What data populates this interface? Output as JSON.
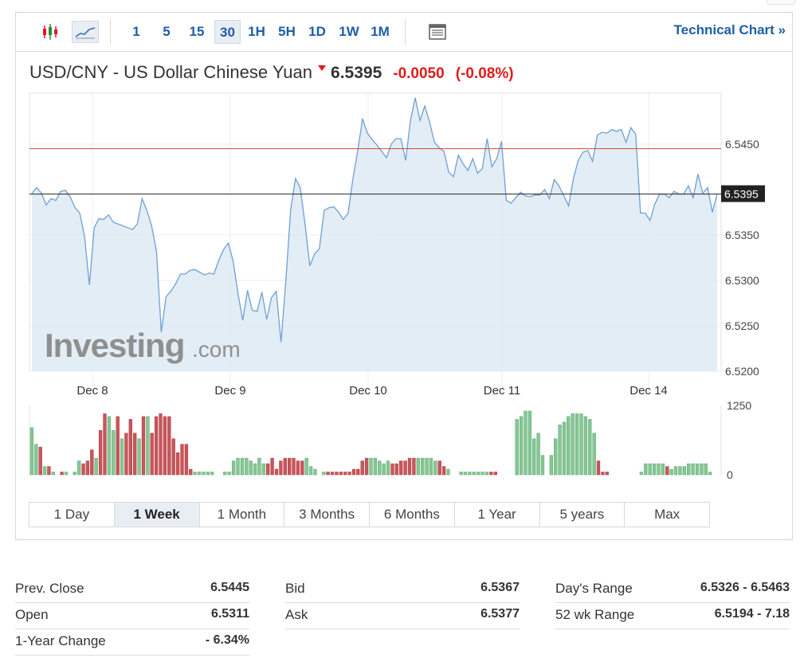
{
  "toolbar": {
    "chart_type_icons": [
      {
        "name": "candlestick-icon",
        "color": "#e01b1b"
      },
      {
        "name": "line-area-icon",
        "color": "#1b5fa8"
      }
    ],
    "intervals": [
      "1",
      "5",
      "15",
      "30",
      "1H",
      "5H",
      "1D",
      "1W",
      "1M"
    ],
    "active_interval": "30",
    "table_icon": "table-view-icon",
    "technical_chart_label": "Technical Chart »"
  },
  "quote": {
    "name": "USD/CNY - US Dollar Chinese Yuan",
    "price": "6.5395",
    "change": "-0.0050",
    "change_pct": "(-0.08%)",
    "direction_icon": "arrow-down-icon"
  },
  "watermark": {
    "brand": "Investing",
    "suffix": ".com"
  },
  "chart_data": {
    "type": "area",
    "x_labels": [
      "Dec 8",
      "Dec 9",
      "Dec 10",
      "Dec 11",
      "Dec 14"
    ],
    "y_ticks": [
      "6.5450",
      "6.5350",
      "6.5300",
      "6.5250",
      "6.5200"
    ],
    "ylim": [
      6.52,
      6.5506
    ],
    "current_price": 6.5395,
    "current_price_label": "6.5395",
    "prev_close": 6.5445,
    "series": [
      {
        "values": [
          6.5396,
          6.5402,
          6.5396,
          6.5383,
          6.539,
          6.5388,
          6.5398,
          6.5399,
          6.5392,
          6.538,
          6.5374,
          6.5348,
          6.5295,
          6.5358,
          6.5368,
          6.5367,
          6.5372,
          6.5364,
          6.5362,
          6.536,
          6.5358,
          6.5356,
          6.5362,
          6.539,
          6.5377,
          6.536,
          6.5332,
          6.5243,
          6.5282,
          6.5288,
          6.5296,
          6.5307,
          6.5307,
          6.5311,
          6.5312,
          6.5309,
          6.5306,
          6.5308,
          6.5307,
          6.5322,
          6.5334,
          6.5341,
          6.5321,
          6.5286,
          6.5256,
          6.5289,
          6.5267,
          6.5266,
          6.5287,
          6.5257,
          6.5281,
          6.5288,
          6.5232,
          6.5299,
          6.5378,
          6.5412,
          6.5402,
          6.5362,
          6.5316,
          6.5329,
          6.5335,
          6.5377,
          6.538,
          6.5381,
          6.5375,
          6.5367,
          6.5374,
          6.5412,
          6.5443,
          6.5478,
          6.5462,
          6.5455,
          6.5449,
          6.5442,
          6.5435,
          6.545,
          6.5456,
          6.5456,
          6.5432,
          6.5476,
          6.5501,
          6.5476,
          6.5492,
          6.5474,
          6.5452,
          6.5446,
          6.5442,
          6.5419,
          6.5414,
          6.5438,
          6.5428,
          6.5421,
          6.5434,
          6.5418,
          6.5423,
          6.5456,
          6.5425,
          6.5434,
          6.5453,
          6.5388,
          6.5385,
          6.5391,
          6.5397,
          6.5393,
          6.5392,
          6.5394,
          6.5394,
          6.54,
          6.539,
          6.5411,
          6.5404,
          6.5393,
          6.5382,
          6.5412,
          6.5432,
          6.5441,
          6.5443,
          6.5431,
          6.546,
          6.5463,
          6.5462,
          6.5466,
          6.5464,
          6.5466,
          6.5452,
          6.5468,
          6.5461,
          6.5374,
          6.5374,
          6.5366,
          6.5384,
          6.5395,
          6.5395,
          6.5391,
          6.5398,
          6.5395,
          6.5395,
          6.5404,
          6.5391,
          6.5417,
          6.5396,
          6.5402,
          6.5375,
          6.5395
        ]
      }
    ],
    "volume": {
      "ylim": [
        0,
        1250
      ],
      "y_ticks": [
        "1250",
        "0"
      ],
      "values": [
        850,
        550,
        500,
        150,
        150,
        50,
        0,
        50,
        50,
        0,
        50,
        250,
        200,
        250,
        450,
        300,
        800,
        1100,
        1050,
        800,
        1050,
        650,
        750,
        1000,
        750,
        650,
        1050,
        1050,
        750,
        1050,
        1100,
        1050,
        1050,
        650,
        400,
        550,
        550,
        100,
        50,
        50,
        50,
        50,
        50,
        0,
        0,
        50,
        50,
        250,
        300,
        300,
        300,
        250,
        200,
        300,
        200,
        200,
        300,
        100,
        250,
        300,
        300,
        300,
        250,
        250,
        300,
        150,
        100,
        0,
        50,
        50,
        50,
        50,
        50,
        50,
        50,
        100,
        100,
        250,
        300,
        300,
        300,
        250,
        200,
        250,
        200,
        200,
        250,
        250,
        300,
        300,
        300,
        300,
        300,
        300,
        250,
        250,
        150,
        100,
        0,
        0,
        50,
        50,
        50,
        50,
        50,
        50,
        50,
        50,
        50,
        0,
        0,
        0,
        0,
        1000,
        1050,
        1150,
        1150,
        650,
        750,
        350,
        0,
        350,
        650,
        900,
        950,
        1050,
        1100,
        1100,
        1100,
        1050,
        1000,
        750,
        250,
        50,
        50,
        0,
        0,
        0,
        0,
        0,
        0,
        0,
        50,
        200,
        200,
        200,
        200,
        200,
        150,
        100,
        150,
        150,
        150,
        200,
        200,
        200,
        200,
        200,
        50,
        0
      ],
      "colors": [
        "g",
        "g",
        "r",
        "g",
        "r",
        "g",
        "g",
        "r",
        "g",
        "g",
        "g",
        "g",
        "r",
        "r",
        "r",
        "g",
        "r",
        "r",
        "g",
        "g",
        "r",
        "g",
        "r",
        "r",
        "r",
        "g",
        "r",
        "g",
        "r",
        "r",
        "r",
        "r",
        "r",
        "r",
        "r",
        "r",
        "r",
        "r",
        "g",
        "g",
        "g",
        "g",
        "g",
        "g",
        "g",
        "g",
        "g",
        "g",
        "g",
        "g",
        "g",
        "g",
        "g",
        "g",
        "g",
        "r",
        "r",
        "r",
        "r",
        "r",
        "r",
        "r",
        "r",
        "r",
        "g",
        "g",
        "g",
        "g",
        "g",
        "r",
        "r",
        "r",
        "r",
        "r",
        "r",
        "r",
        "r",
        "r",
        "r",
        "g",
        "g",
        "g",
        "g",
        "g",
        "r",
        "r",
        "r",
        "r",
        "r",
        "r",
        "g",
        "g",
        "g",
        "g",
        "g",
        "r",
        "r",
        "g",
        "g",
        "g",
        "g",
        "g",
        "g",
        "g",
        "g",
        "g",
        "g",
        "r",
        "r",
        "r",
        "r",
        "r",
        "g",
        "g",
        "g",
        "g",
        "g",
        "g",
        "g",
        "g",
        "g",
        "g",
        "g",
        "g",
        "g",
        "g",
        "g",
        "g",
        "g",
        "g",
        "g",
        "g",
        "r",
        "r",
        "r",
        "r",
        "r",
        "r",
        "r",
        "r",
        "r",
        "g",
        "g",
        "g",
        "g",
        "g",
        "g",
        "g",
        "r",
        "g",
        "g",
        "g"
      ],
      "color_map": {
        "g": "#86c795",
        "r": "#c9565b"
      }
    }
  },
  "range_tabs": [
    "1 Day",
    "1 Week",
    "1 Month",
    "3 Months",
    "6 Months",
    "1 Year",
    "5 years",
    "Max"
  ],
  "active_range": "1 Week",
  "stats": [
    [
      {
        "label": "Prev. Close",
        "value": "6.5445"
      },
      {
        "label": "Open",
        "value": "6.5311"
      },
      {
        "label": "1-Year Change",
        "value": "- 6.34%"
      }
    ],
    [
      {
        "label": "Bid",
        "value": "6.5367"
      },
      {
        "label": "Ask",
        "value": "6.5377"
      }
    ],
    [
      {
        "label": "Day's Range",
        "value": "6.5326 - 6.5463"
      },
      {
        "label": "52 wk Range",
        "value": "6.5194 - 7.18"
      }
    ]
  ]
}
